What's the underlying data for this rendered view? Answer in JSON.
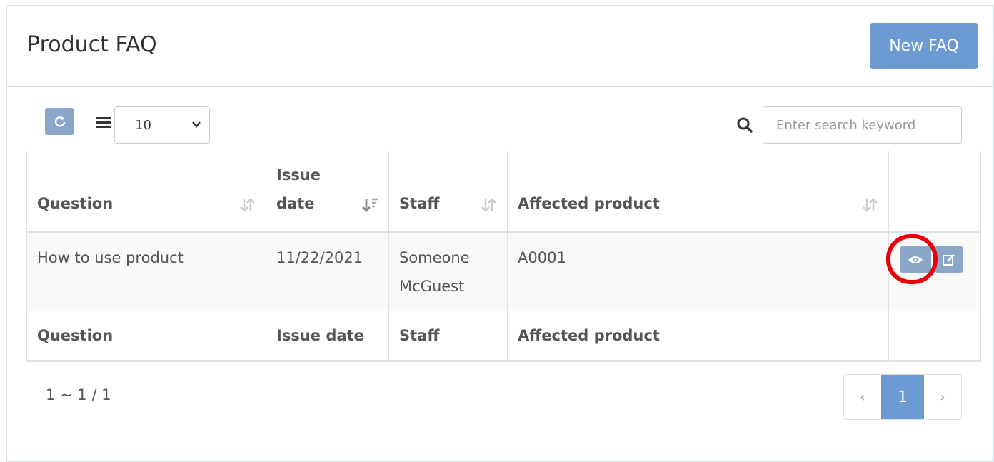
{
  "header": {
    "title": "Product FAQ",
    "new_button": "New FAQ"
  },
  "toolbar": {
    "page_size": "10",
    "search_placeholder": "Enter search keyword"
  },
  "table": {
    "columns": [
      "Question",
      "Issue date",
      "Staff",
      "Affected product"
    ],
    "header_lines": {
      "question": "Question",
      "issue_date_1": "Issue",
      "issue_date_2": "date",
      "staff": "Staff",
      "affected": "Affected product"
    },
    "rows": [
      {
        "question": "How to use product",
        "issue_date": "11/22/2021",
        "staff_1": "Someone",
        "staff_2": "McGuest",
        "affected": "A0001"
      }
    ]
  },
  "footer": {
    "summary": "1 ~ 1 / 1",
    "current_page": "1",
    "prev": "‹",
    "next": "›"
  },
  "colors": {
    "primary": "#6b9bd2",
    "muted_button": "#8aa6c8",
    "highlight": "#e8000a"
  }
}
